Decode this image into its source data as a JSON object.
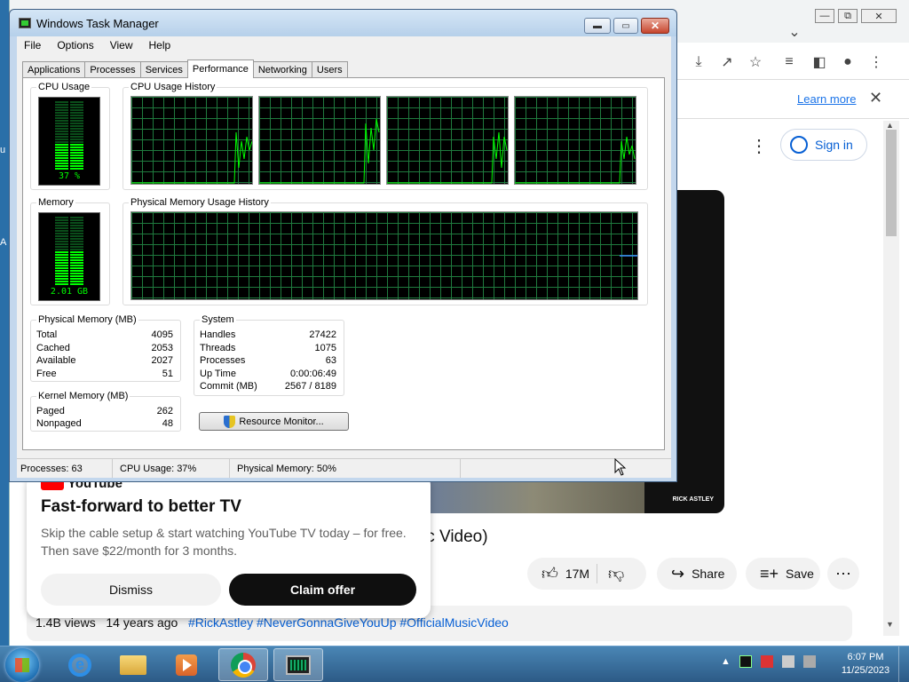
{
  "desktop": {
    "stub_u": "u",
    "stub_a": "A"
  },
  "chrome": {
    "minimize": "—",
    "restore": "⧉",
    "close": "✕",
    "tab_menu": "⌄",
    "learn_more": "Learn more",
    "infobar_close": "✕",
    "signin": "Sign in"
  },
  "video": {
    "caption": "RICK ASTLEY",
    "title_fragment": "ic Video)"
  },
  "actions": {
    "likes": "17M",
    "share": "Share",
    "save": "Save"
  },
  "meta": {
    "views": "1.4B views",
    "age": "14 years ago",
    "tags": "#RickAstley #NeverGonnaGiveYouUp #OfficialMusicVideo"
  },
  "promo": {
    "logo": "YouTube",
    "title": "Fast-forward to better TV",
    "text": "Skip the cable setup & start watching YouTube TV today – for free. Then save $22/month for 3 months.",
    "dismiss": "Dismiss",
    "claim": "Claim offer"
  },
  "taskmanager": {
    "title": "Windows Task Manager",
    "menu": [
      "File",
      "Options",
      "View",
      "Help"
    ],
    "tabs": [
      "Applications",
      "Processes",
      "Services",
      "Performance",
      "Networking",
      "Users"
    ],
    "active_tab": "Performance",
    "groups": {
      "cpu_usage": "CPU Usage",
      "cpu_history": "CPU Usage History",
      "memory": "Memory",
      "mem_history": "Physical Memory Usage History",
      "physical_memory": "Physical Memory (MB)",
      "kernel_memory": "Kernel Memory (MB)",
      "system": "System"
    },
    "cpu_meter": "37 %",
    "cpu_fraction": 0.37,
    "mem_meter": "2.01 GB",
    "mem_fraction": 0.5,
    "physical_memory": [
      {
        "label": "Total",
        "value": "4095"
      },
      {
        "label": "Cached",
        "value": "2053"
      },
      {
        "label": "Available",
        "value": "2027"
      },
      {
        "label": "Free",
        "value": "51"
      }
    ],
    "kernel_memory": [
      {
        "label": "Paged",
        "value": "262"
      },
      {
        "label": "Nonpaged",
        "value": "48"
      }
    ],
    "system": [
      {
        "label": "Handles",
        "value": "27422"
      },
      {
        "label": "Threads",
        "value": "1075"
      },
      {
        "label": "Processes",
        "value": "63"
      },
      {
        "label": "Up Time",
        "value": "0:00:06:49"
      },
      {
        "label": "Commit (MB)",
        "value": "2567 / 8189"
      }
    ],
    "resource_monitor": "Resource Monitor...",
    "status": {
      "processes": "Processes: 63",
      "cpu": "CPU Usage: 37%",
      "memory": "Physical Memory: 50%"
    }
  },
  "taskbar": {
    "time": "6:07 PM",
    "date": "11/25/2023"
  },
  "colors": {
    "meter_green": "#00ff00",
    "grid_green": "#1f7a3e",
    "youtube_red": "#ff0000",
    "link_blue": "#065fd4"
  }
}
